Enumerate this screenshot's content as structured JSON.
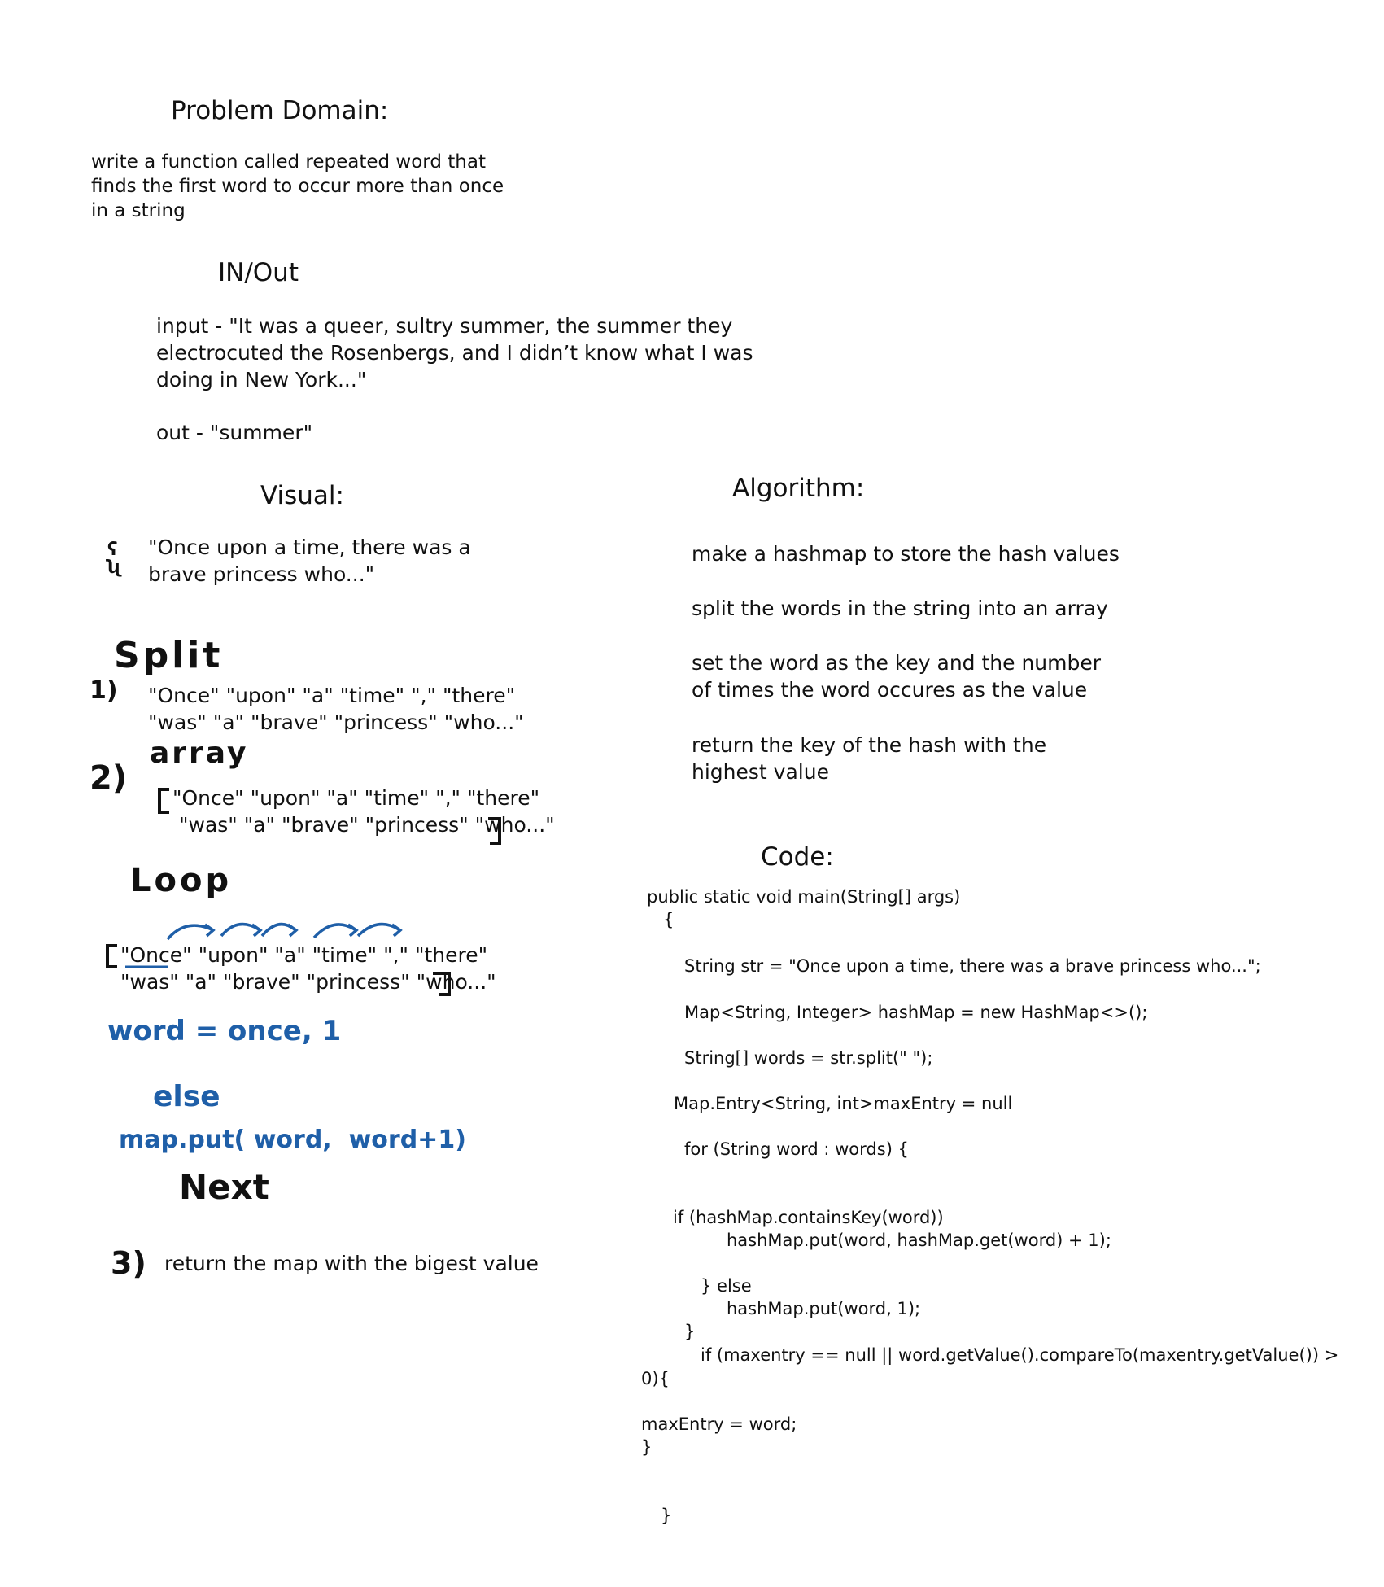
{
  "problem": {
    "heading": "Problem Domain:",
    "lines": [
      "write a function called repeated word that",
      "finds the first word to occur more than once",
      "in a string"
    ]
  },
  "inout": {
    "heading": "IN/Out",
    "input_lines": [
      "input - \"It was a queer, sultry summer, the summer they",
      "electrocuted the Rosenbergs, and I didn’t know what I was",
      "doing in New York...\""
    ],
    "output_line": "out - \"summer\""
  },
  "visual": {
    "heading": "Visual:",
    "side_mark": "ʕ ʯ",
    "example_lines": [
      "\"Once upon a time, there was a",
      "brave princess who...\""
    ],
    "split_label": "Split",
    "step1_num": "1)",
    "step1_lines": [
      "\"Once\" \"upon\" \"a\" \"time\" \",\" \"there\"",
      "\"was\" \"a\" \"brave\" \"princess\" \"who...\""
    ],
    "array_label": "array",
    "step2_num": "2)",
    "step2_lines": [
      "\"Once\" \"upon\" \"a\" \"time\" \",\" \"there\"",
      "\"was\" \"a\" \"brave\" \"princess\" \"who...\""
    ],
    "loop_label": "Loop",
    "loop_lines": [
      "\"Once\" \"upon\" \"a\" \"time\" \",\" \"there\"",
      "\"was\" \"a\" \"brave\" \"princess\" \"who...\""
    ],
    "hand_word": "word = once, 1",
    "hand_else": "else",
    "hand_put": "map.put( word,  word+1)",
    "hand_next": "Next",
    "step3_num": "3)",
    "step3_text": "return the map with the bigest value"
  },
  "algorithm": {
    "heading": "Algorithm:",
    "steps": [
      [
        "make a hashmap to store the hash values"
      ],
      [
        "split the words in the string into an array"
      ],
      [
        "set the word as the key and the number",
        "of times the word occures as the value"
      ],
      [
        "return the key of the hash with the",
        "highest value"
      ]
    ]
  },
  "code": {
    "heading": "Code:",
    "lines": [
      "public static void main(String[] args)",
      "{",
      "String str = \"Once upon a time, there was a brave princess who...\";",
      "Map<String, Integer> hashMap = new HashMap<>();",
      "String[] words = str.split(\" \");",
      "Map.Entry<String, int>maxEntry = null",
      "for (String word : words) {",
      "if (hashMap.containsKey(word))",
      "hashMap.put(word, hashMap.get(word) + 1);",
      "} else",
      "hashMap.put(word, 1);",
      "}",
      "if (maxentry == null || word.getValue().compareTo(maxentry.getValue()) >",
      "0){",
      "maxEntry = word;",
      "}",
      "}"
    ]
  }
}
